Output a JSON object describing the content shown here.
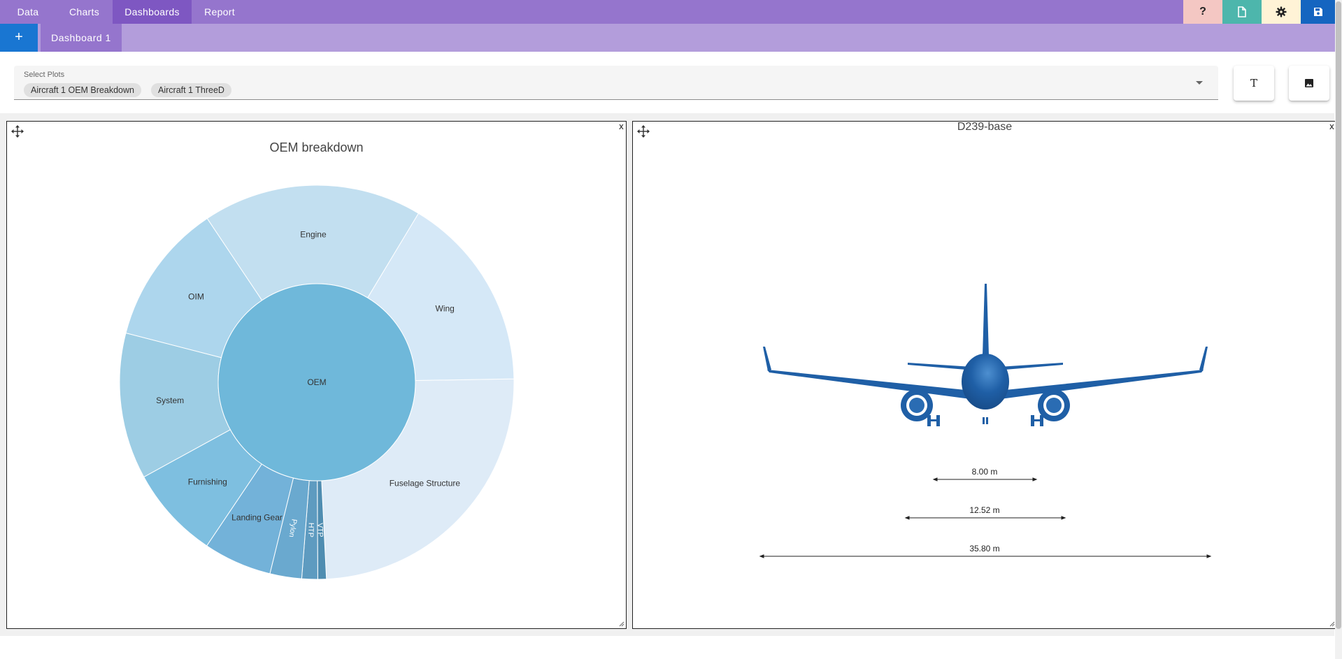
{
  "nav": {
    "tabs": [
      {
        "label": "Data"
      },
      {
        "label": "Charts"
      },
      {
        "label": "Dashboards"
      },
      {
        "label": "Report"
      }
    ],
    "active_tab": "Dashboards",
    "toolbar": [
      {
        "icon": "help-icon",
        "glyph": "?",
        "bg": "#f4c7c3"
      },
      {
        "icon": "document-icon",
        "bg": "#4db6ac"
      },
      {
        "icon": "gear-icon",
        "bg": "#fff3d6"
      },
      {
        "icon": "save-icon",
        "bg": "#1565c0"
      }
    ]
  },
  "dashboard_tabs": {
    "add_label": "+",
    "tabs": [
      {
        "label": "Dashboard 1"
      }
    ]
  },
  "plot_select": {
    "label": "Select Plots",
    "chips": [
      "Aircraft 1 OEM Breakdown",
      "Aircraft 1 ThreeD"
    ]
  },
  "side_buttons": {
    "text_glyph": "T",
    "image_icon": "image-icon"
  },
  "panels": {
    "close_glyph": "x",
    "oem": {
      "close": "x"
    },
    "threed": {
      "title": "D239-base",
      "close": "x",
      "dimensions": [
        "8.00 m",
        "12.52 m",
        "35.80 m"
      ],
      "color": "#1f5fa6"
    }
  },
  "chart_data": {
    "type": "sunburst",
    "title": "OEM breakdown",
    "root": "OEM",
    "segments": [
      {
        "label": "Fuselage Structure",
        "share_pct": 24.5,
        "color": "#deebf7"
      },
      {
        "label": "VTP",
        "share_pct": 0.7,
        "color": "#4f8db1"
      },
      {
        "label": "HTP",
        "share_pct": 1.3,
        "color": "#5e9bc0"
      },
      {
        "label": "Pylon",
        "share_pct": 2.6,
        "color": "#6aa9cf"
      },
      {
        "label": "Landing Gear",
        "share_pct": 5.6,
        "color": "#73b2d9"
      },
      {
        "label": "Furnishing",
        "share_pct": 7.6,
        "color": "#7ebfe0"
      },
      {
        "label": "System",
        "share_pct": 12.0,
        "color": "#9dcde4"
      },
      {
        "label": "OIM",
        "share_pct": 11.6,
        "color": "#add6ed"
      },
      {
        "label": "Engine",
        "share_pct": 18.0,
        "color": "#c2dff0"
      },
      {
        "label": "Wing",
        "share_pct": 16.1,
        "color": "#d5e8f7"
      }
    ],
    "root_color": "#6fb8da"
  }
}
